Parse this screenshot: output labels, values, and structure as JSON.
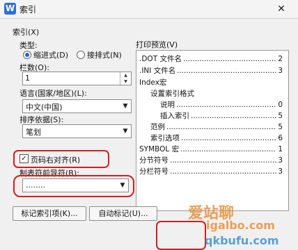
{
  "window": {
    "title": "索引",
    "app_icon_letter": "W",
    "close_glyph": "✕"
  },
  "index_group": {
    "label": "索引(X)"
  },
  "type": {
    "label": "类型:",
    "options": [
      {
        "label": "缩进式(D)",
        "selected": true
      },
      {
        "label": "接排式(N)",
        "selected": false
      }
    ]
  },
  "columns": {
    "label": "栏数(O):",
    "value": "1"
  },
  "language": {
    "label": "语言(国家/地区)(L):",
    "value": "中文(中国)"
  },
  "sort_by": {
    "label": "排序依据(S):",
    "value": "笔划"
  },
  "right_align": {
    "label": "页码右对齐(R)",
    "checked": true,
    "check_glyph": "✓"
  },
  "tab_leader": {
    "label": "制表符前导符(B):",
    "value": "........"
  },
  "preview": {
    "label": "打印预览(V)",
    "rows": [
      {
        "text": ".DOT 文件名",
        "num": "2",
        "dots": "……………………"
      },
      {
        "text": ".INI 文件名",
        "num": "3",
        "dots": "……………………"
      },
      {
        "text": "Index宏",
        "num": "",
        "dots": ""
      },
      {
        "text": "设置索引格式",
        "num": "",
        "dots": ""
      },
      {
        "text": "说明",
        "num": "0",
        "dots": "……………………"
      },
      {
        "text": "插入索引",
        "num": "5",
        "dots": "……………………"
      },
      {
        "text": "范例",
        "num": "5",
        "dots": "……………………"
      },
      {
        "text": "索引选项",
        "num": "6",
        "dots": "……………………"
      },
      {
        "text": "SYMBOL 宏",
        "num": "1",
        "dots": "……………………"
      },
      {
        "text": "分节符号",
        "num": "3",
        "dots": "……………………"
      },
      {
        "text": "分栏符号",
        "num": "3",
        "dots": "……………………"
      }
    ]
  },
  "buttons": {
    "mark_entry": "标记索引项(K)...",
    "auto_mark": "自动标记(U)..."
  },
  "watermark": {
    "line1": "爱站聊",
    "line2": "igalbo.com",
    "line3": "qkbufu.com"
  },
  "colors": {
    "highlight": "#d11e1e",
    "accent": "#2d62c7"
  }
}
